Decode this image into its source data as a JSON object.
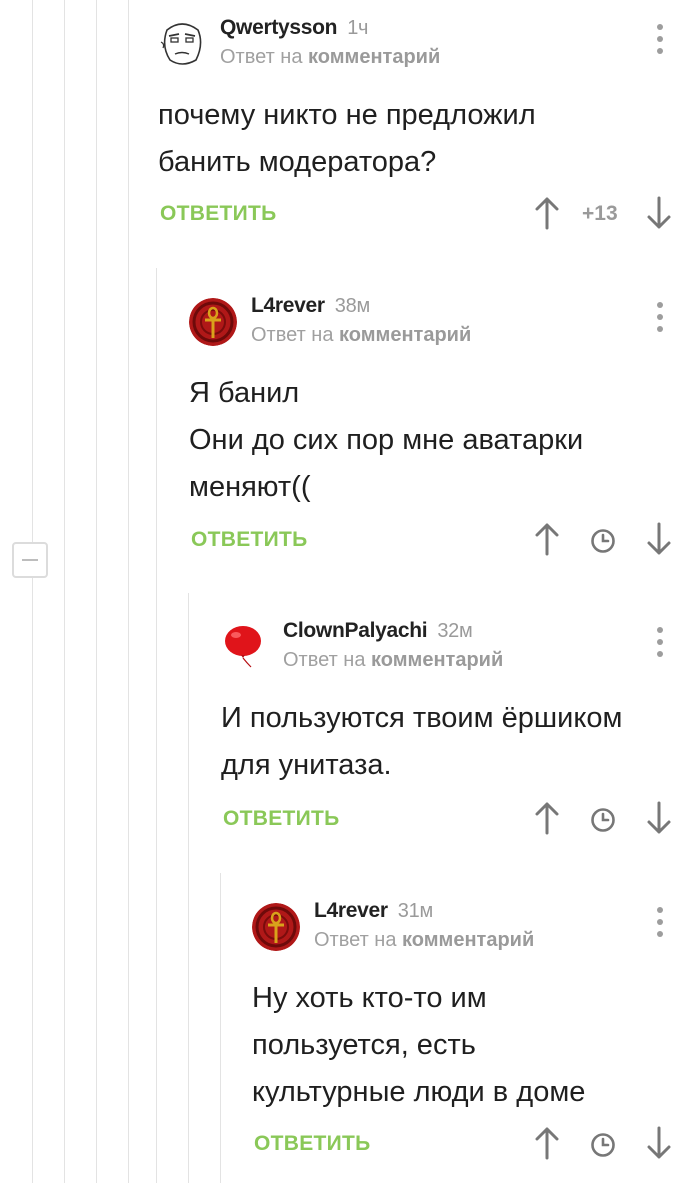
{
  "comments": [
    {
      "author": "Qwertysson",
      "time": "1ч",
      "reply_prefix": "Ответ на",
      "reply_target": "комментарий",
      "text": "почему никто не предложил\nбанить модератора?",
      "reply_label": "ОТВЕТИТЬ",
      "rating": "+13",
      "avatar": "troll-face-avatar"
    },
    {
      "author": "L4rever",
      "time": "38м",
      "reply_prefix": "Ответ на",
      "reply_target": "комментарий",
      "text": "Я банил\nОни до сих пор мне аватарки\nменяют((",
      "reply_label": "ОТВЕТИТЬ",
      "avatar": "ankh-avatar"
    },
    {
      "author": "ClownPalyachi",
      "time": "32м",
      "reply_prefix": "Ответ на",
      "reply_target": "комментарий",
      "text": "И пользуются твоим ёршиком\nдля унитаза.",
      "reply_label": "ОТВЕТИТЬ",
      "avatar": "red-balloon-avatar"
    },
    {
      "author": "L4rever",
      "time": "31м",
      "reply_prefix": "Ответ на",
      "reply_target": "комментарий",
      "text": "Ну хоть кто-то им\nпользуется, есть\nкультурные люди в доме",
      "reply_label": "ОТВЕТИТЬ",
      "avatar": "ankh-avatar"
    }
  ],
  "colors": {
    "accent_green": "#8ac858",
    "muted_gray": "#9a9a9a",
    "thread_line": "#e3e3e3"
  }
}
